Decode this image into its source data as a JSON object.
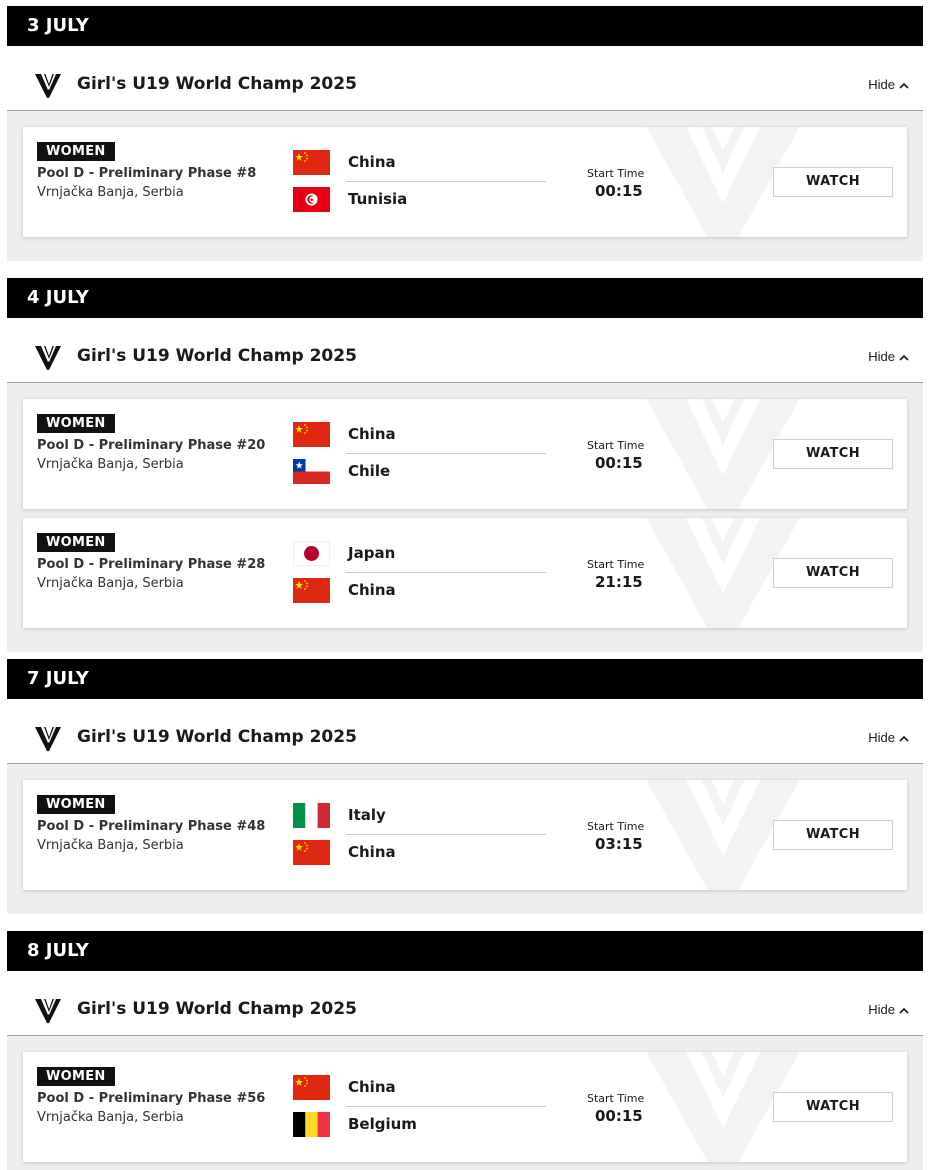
{
  "competition": "Girl's U19 World Champ 2025",
  "hide_label": "Hide",
  "gender_label": "WOMEN",
  "start_time_label": "Start Time",
  "watch_label": "WATCH",
  "flag_colors": {
    "china_red": "#de2910",
    "china_star": "#ffde00",
    "tunisia_red": "#e70013",
    "chile_blue": "#0039a6",
    "chile_red": "#d52b1e",
    "japan_red": "#bc002d",
    "italy_green": "#009246",
    "italy_red": "#ce2b37",
    "belgium_yellow": "#fdda24",
    "belgium_red": "#ef3340"
  },
  "days": [
    {
      "label": "3 JULY",
      "matches": [
        {
          "phase": "Pool D - Preliminary Phase #8",
          "venue": "Vrnjačka Banja, Serbia",
          "team1": "China",
          "flag1": "china",
          "team2": "Tunisia",
          "flag2": "tunisia",
          "time": "00:15"
        }
      ]
    },
    {
      "label": "4 JULY",
      "matches": [
        {
          "phase": "Pool D - Preliminary Phase #20",
          "venue": "Vrnjačka Banja, Serbia",
          "team1": "China",
          "flag1": "china",
          "team2": "Chile",
          "flag2": "chile",
          "time": "00:15"
        },
        {
          "phase": "Pool D - Preliminary Phase #28",
          "venue": "Vrnjačka Banja, Serbia",
          "team1": "Japan",
          "flag1": "japan",
          "team2": "China",
          "flag2": "china",
          "time": "21:15"
        }
      ]
    },
    {
      "label": "7 JULY",
      "matches": [
        {
          "phase": "Pool D - Preliminary Phase #48",
          "venue": "Vrnjačka Banja, Serbia",
          "team1": "Italy",
          "flag1": "italy",
          "team2": "China",
          "flag2": "china",
          "time": "03:15"
        }
      ]
    },
    {
      "label": "8 JULY",
      "matches": [
        {
          "phase": "Pool D - Preliminary Phase #56",
          "venue": "Vrnjačka Banja, Serbia",
          "team1": "China",
          "flag1": "china",
          "team2": "Belgium",
          "flag2": "belgium",
          "time": "00:15"
        }
      ]
    }
  ]
}
